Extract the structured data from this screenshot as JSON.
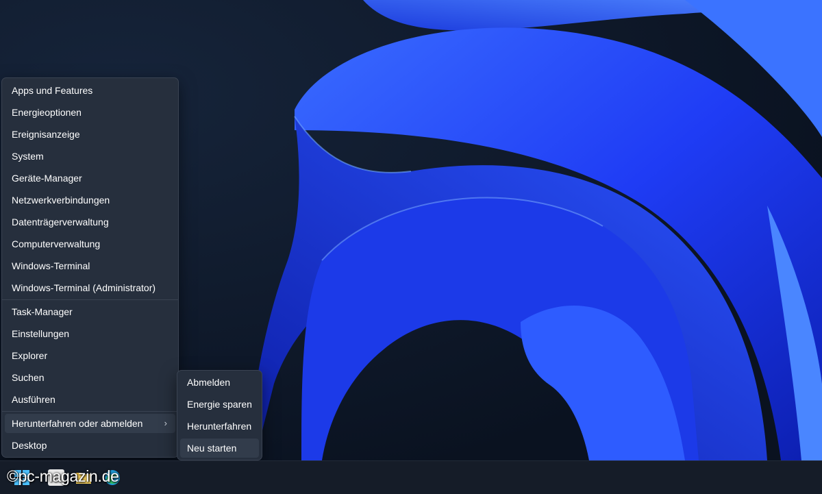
{
  "context_menu": {
    "group1": [
      "Apps und Features",
      "Energieoptionen",
      "Ereignisanzeige",
      "System",
      "Geräte-Manager",
      "Netzwerkverbindungen",
      "Datenträgerverwaltung",
      "Computerverwaltung",
      "Windows-Terminal",
      "Windows-Terminal (Administrator)"
    ],
    "group2": [
      "Task-Manager",
      "Einstellungen",
      "Explorer",
      "Suchen",
      "Ausführen"
    ],
    "group3": [
      "Herunterfahren oder abmelden",
      "Desktop"
    ],
    "submenu_chevron": "›"
  },
  "submenu": {
    "items": [
      "Abmelden",
      "Energie sparen",
      "Herunterfahren",
      "Neu starten"
    ]
  },
  "watermark": "©pc-magazin.de",
  "taskbar_icons": [
    "windows-start-icon",
    "search-icon",
    "file-explorer-icon",
    "edge-icon"
  ],
  "colors": {
    "menu_bg": "#262f3d",
    "highlight": "#323c4b",
    "wallpaper_blue": "#1f3cf5"
  }
}
